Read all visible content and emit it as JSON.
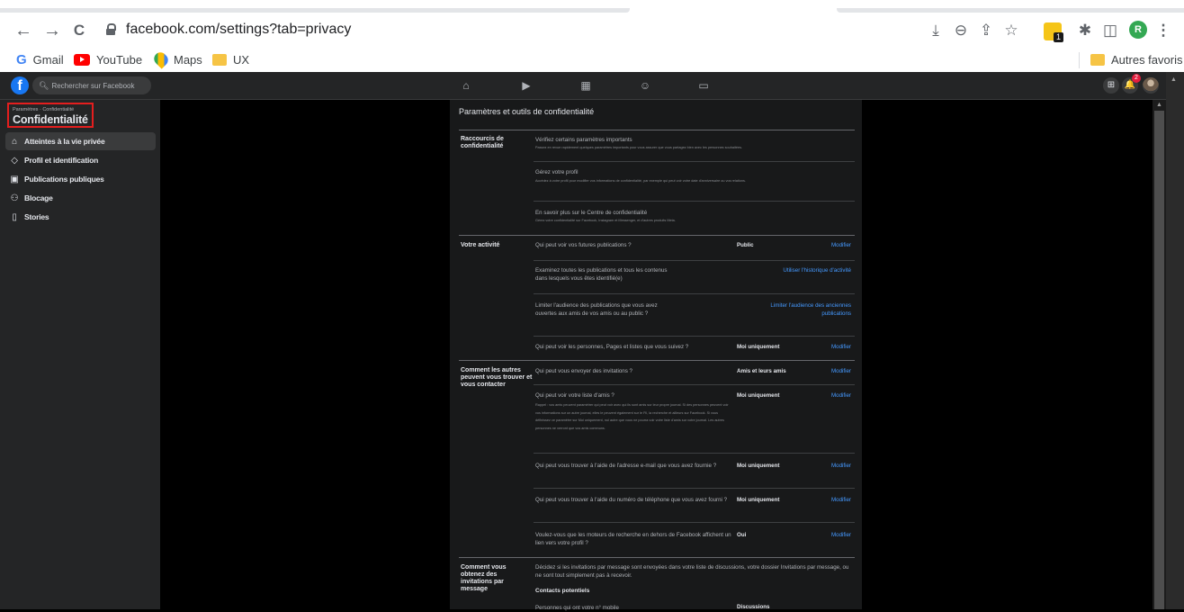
{
  "browser": {
    "url": "facebook.com/settings?tab=privacy",
    "icons": {
      "back": "←",
      "forward": "→",
      "reload": "C",
      "install": "⤓",
      "zoom": "⊖",
      "share": "⇪",
      "star": "☆",
      "puzzle": "✱",
      "sidepanel": "◫",
      "menu": "⋮"
    },
    "extension_badge": "1",
    "profile_initial": "R",
    "bookmarks": [
      {
        "label": "Gmail",
        "icon": "G"
      },
      {
        "label": "YouTube",
        "icon": "youtube-icon"
      },
      {
        "label": "Maps",
        "icon": "maps-icon"
      },
      {
        "label": "UX",
        "icon": "folder-icon"
      }
    ],
    "other_bookmarks": "Autres favoris"
  },
  "fb": {
    "logo": "f",
    "search_placeholder": "Rechercher sur Facebook",
    "nav_icons": [
      "⌂",
      "▶",
      "▦",
      "☺",
      "▭"
    ],
    "menu_icon": "⊞",
    "notif_icon": "🔔",
    "notif_count": "2"
  },
  "sidebar": {
    "breadcrumb": "Paramètres · Confidentialité",
    "title": "Confidentialité",
    "items": [
      {
        "label": "Atteintes à la vie privée",
        "icon": "🔒",
        "active": true
      },
      {
        "label": "Profil et identification",
        "icon": "◇",
        "active": false
      },
      {
        "label": "Publications publiques",
        "icon": "▣",
        "active": false
      },
      {
        "label": "Blocage",
        "icon": "⚇",
        "active": false
      },
      {
        "label": "Stories",
        "icon": "▯",
        "active": false
      }
    ]
  },
  "panel": {
    "title": "Paramètres et outils de confidentialité",
    "sections": {
      "shortcuts": {
        "label": "Raccourcis de confidentialité",
        "rows": [
          {
            "q": "Vérifiez certains paramètres importants",
            "desc": "Passez en revue rapidement quelques paramètres importants pour vous assurer que vous partagez bien avec les personnes souhaitées."
          },
          {
            "q": "Gérez votre profil",
            "desc": "Accédez à votre profil pour modifier vos informations de confidentialité, par exemple qui peut voir votre date d'anniversaire ou vos relations."
          },
          {
            "q": "En savoir plus sur le Centre de confidentialité",
            "desc": "Gérez votre confidentialité sur Facebook, Instagram et Messenger, et d'autres produits Meta."
          }
        ]
      },
      "activity": {
        "label": "Votre activité",
        "rows": [
          {
            "q": "Qui peut voir vos futures publications ?",
            "value": "Public",
            "action": "Modifier"
          },
          {
            "q": "Examinez toutes les publications et tous les contenus dans lesquels vous êtes identifié(e)",
            "action": "Utiliser l'historique d'activité"
          },
          {
            "q": "Limiter l'audience des publications que vous avez ouvertes aux amis de vos amis ou au public ?",
            "action": "Limiter l'audience des anciennes publications"
          },
          {
            "q": "Qui peut voir les personnes, Pages et listes que vous suivez ?",
            "value": "Moi uniquement",
            "action": "Modifier"
          }
        ]
      },
      "find": {
        "label": "Comment les autres peuvent vous trouver et vous contacter",
        "rows": [
          {
            "q": "Qui peut vous envoyer des invitations ?",
            "value": "Amis et leurs amis",
            "action": "Modifier"
          },
          {
            "q": "Qui peut voir votre liste d'amis ?",
            "value": "Moi uniquement",
            "action": "Modifier",
            "desc": "Rappel : vos amis peuvent paramétrer qui peut voir avec qui ils sont amis sur leur propre journal. Si des personnes peuvent voir vos informations sur un autre journal, elles le peuvent également sur le Fil, la recherche et ailleurs sur Facebook. Si vous définissez ce paramètre sur Moi uniquement, nul autre que vous ne pourra voir votre liste d'amis sur votre journal. Les autres personnes ne verront que vos amis communs."
          },
          {
            "q": "Qui peut vous trouver à l'aide de l'adresse e-mail que vous avez fournie ?",
            "value": "Moi uniquement",
            "action": "Modifier"
          },
          {
            "q": "Qui peut vous trouver à l'aide du numéro de téléphone que vous avez fourni ?",
            "value": "Moi uniquement",
            "action": "Modifier"
          },
          {
            "q": "Voulez-vous que les moteurs de recherche en dehors de Facebook affichent un lien vers votre profil ?",
            "value": "Oui",
            "action": "Modifier"
          }
        ]
      },
      "invites": {
        "label": "Comment vous obtenez des invitations par message",
        "q": "Décidez si les invitations par message sont envoyées dans votre liste de discussions, votre dossier Invitations par message, ou ne sont tout simplement pas à recevoir.",
        "subhead": "Contacts potentiels",
        "row_q": "Personnes qui ont votre n° mobile",
        "row_value": "Discussions"
      }
    }
  }
}
